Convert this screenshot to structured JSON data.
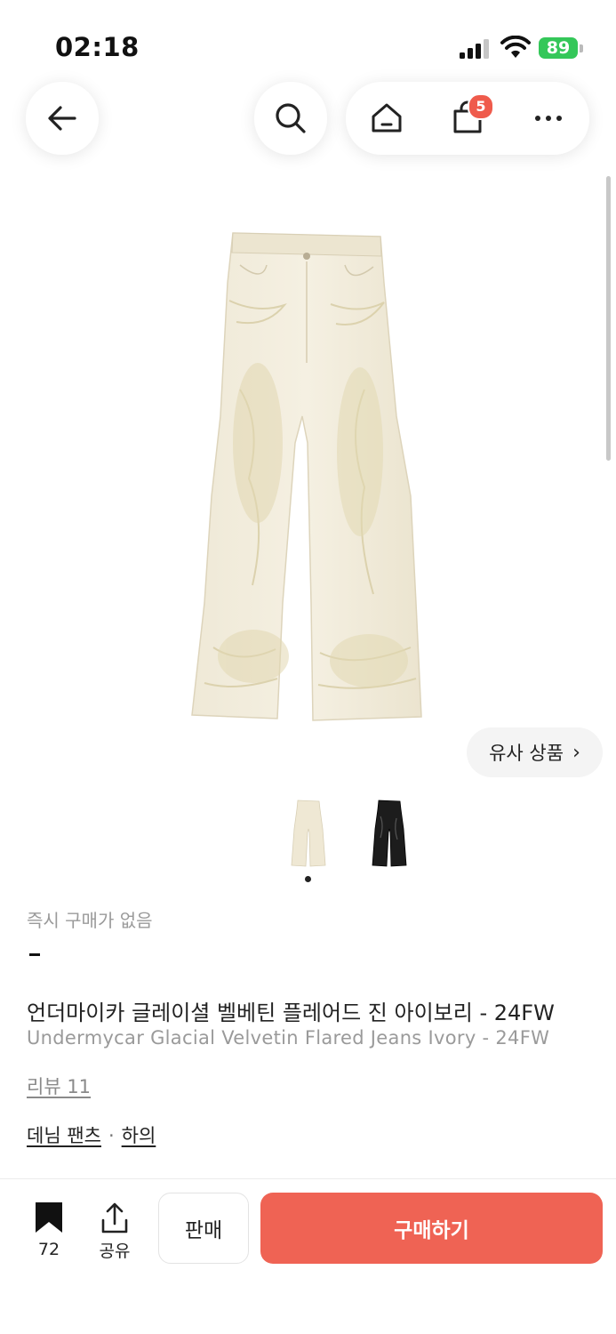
{
  "status_bar": {
    "time": "02:18",
    "battery": "89",
    "battery_color": "#34c759"
  },
  "nav": {
    "back_icon": "arrow-left-icon",
    "search_icon": "search-icon",
    "home_icon": "home-icon",
    "cart_icon": "shopping-bag-icon",
    "cart_badge": "5",
    "more_icon": "more-icon"
  },
  "product": {
    "image_icon": "flared-jeans-ivory",
    "similar_label": "유사 상품",
    "similar_chevron": "›",
    "thumbnails": [
      "ivory-jeans-thumb",
      "black-jeans-thumb"
    ],
    "instant_status": "즉시 구매가 없음",
    "title_ko": "언더마이카 글레이셜 벨베틴 플레어드 진 아이보리 - 24FW",
    "title_en": "Undermycar Glacial Velvetin Flared Jeans Ivory - 24FW",
    "review_label": "리뷰 11",
    "category": {
      "primary": "데님 팬츠",
      "separator": "·",
      "secondary": "하의"
    }
  },
  "bottom_bar": {
    "bookmark_count": "72",
    "share_label": "공유",
    "sell_label": "판매",
    "buy_label": "구매하기",
    "accent_color": "#ef6354"
  }
}
